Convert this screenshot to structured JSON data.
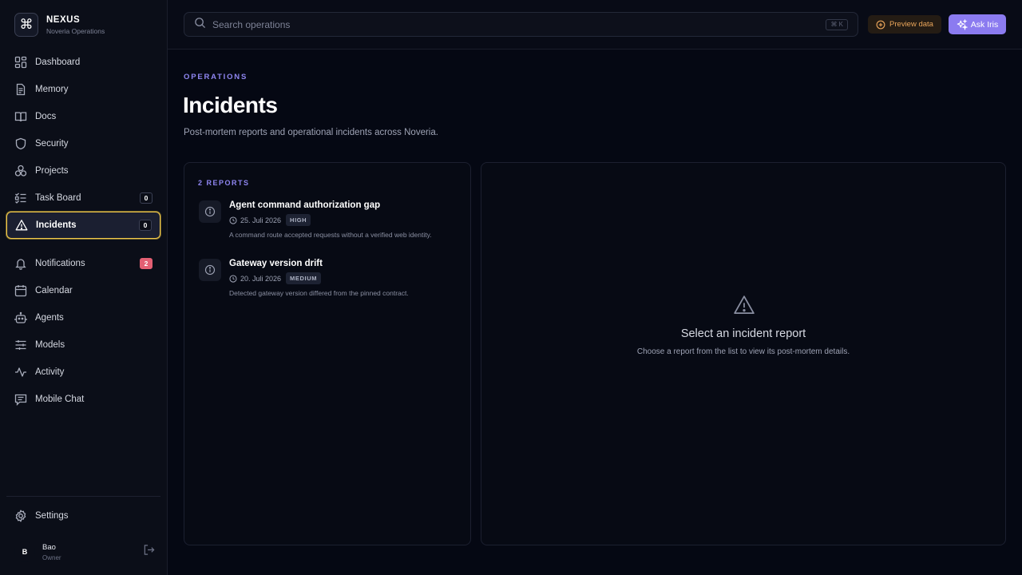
{
  "brand": {
    "name": "NEXUS",
    "subtitle": "Noveria Operations",
    "logo_icon": "command-icon"
  },
  "nav": [
    {
      "label": "Dashboard",
      "icon": "dashboard-icon"
    },
    {
      "label": "Memory",
      "icon": "file-icon"
    },
    {
      "label": "Docs",
      "icon": "book-icon"
    },
    {
      "label": "Security",
      "icon": "shield-icon"
    },
    {
      "label": "Projects",
      "icon": "boxes-icon"
    },
    {
      "label": "Task Board",
      "icon": "checklist-icon",
      "badge": "0"
    },
    {
      "label": "Incidents",
      "icon": "warning-icon",
      "badge": "0",
      "active": true
    },
    {
      "label": "Notifications",
      "icon": "bell-icon",
      "badge": "2"
    },
    {
      "label": "Calendar",
      "icon": "calendar-icon"
    },
    {
      "label": "Agents",
      "icon": "bot-icon"
    },
    {
      "label": "Models",
      "icon": "sliders-icon"
    },
    {
      "label": "Activity",
      "icon": "activity-icon"
    },
    {
      "label": "Mobile Chat",
      "icon": "chat-icon"
    }
  ],
  "settings": {
    "label": "Settings",
    "icon": "gear-icon"
  },
  "user": {
    "initial": "B",
    "name": "Bao",
    "role": "Owner"
  },
  "search": {
    "placeholder": "Search operations",
    "shortcut": "⌘ K"
  },
  "actions": {
    "preview_label": "Preview data",
    "ask_label": "Ask Iris"
  },
  "colors": {
    "accent": "#8b7bf0",
    "active_border": "#f2c94c",
    "badge_red": "#e35f73",
    "preview": "#e9a55a"
  },
  "page": {
    "eyebrow": "OPERATIONS",
    "title": "Incidents",
    "subtitle": "Post-mortem reports and operational incidents across Noveria."
  },
  "reports": {
    "count_label": "2 REPORTS",
    "items": [
      {
        "title": "Agent command authorization gap",
        "date": "25. Juli 2026",
        "severity": "HIGH",
        "description": "A command route accepted requests without a verified web identity."
      },
      {
        "title": "Gateway version drift",
        "date": "20. Juli 2026",
        "severity": "MEDIUM",
        "description": "Detected gateway version differed from the pinned contract."
      }
    ]
  },
  "detail": {
    "empty_title": "Select an incident report",
    "empty_subtitle": "Choose a report from the list to view its post-mortem details."
  }
}
